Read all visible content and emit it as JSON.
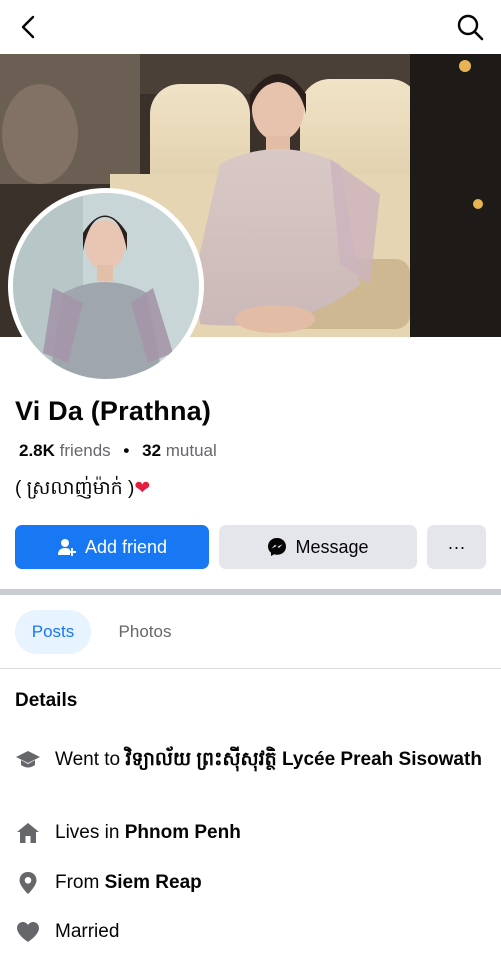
{
  "header": {
    "back_icon": "chevron-left-icon",
    "search_icon": "search-icon"
  },
  "profile": {
    "name": "Vi Da (Prathna)",
    "friends_count": "2.8K",
    "friends_label": "friends",
    "separator": "•",
    "mutual_count": "32",
    "mutual_label": "mutual",
    "bio_text": "( ស្រលាញ់ម៉ាក់ )",
    "bio_emoji": "❤"
  },
  "actions": {
    "add_friend_label": "Add friend",
    "message_label": "Message",
    "more_label": "···"
  },
  "tabs": [
    {
      "label": "Posts",
      "active": true
    },
    {
      "label": "Photos",
      "active": false
    }
  ],
  "details": {
    "title": "Details",
    "items": [
      {
        "icon": "graduation-cap-icon",
        "prefix": "Went to ",
        "value": "វិទ្យាល័យ ព្រះស៊ីសុវត្ថិ Lycée Preah Sisowath"
      },
      {
        "icon": "home-icon",
        "prefix": "Lives in ",
        "value": "Phnom Penh"
      },
      {
        "icon": "location-pin-icon",
        "prefix": "From ",
        "value": "Siem Reap"
      },
      {
        "icon": "heart-icon",
        "prefix": "Married",
        "value": ""
      }
    ]
  },
  "colors": {
    "primary": "#1877f2",
    "secondary_button": "#e4e6eb",
    "muted_text": "#65676b",
    "heart": "#e41e3f",
    "active_tab_bg": "#e7f3ff"
  }
}
